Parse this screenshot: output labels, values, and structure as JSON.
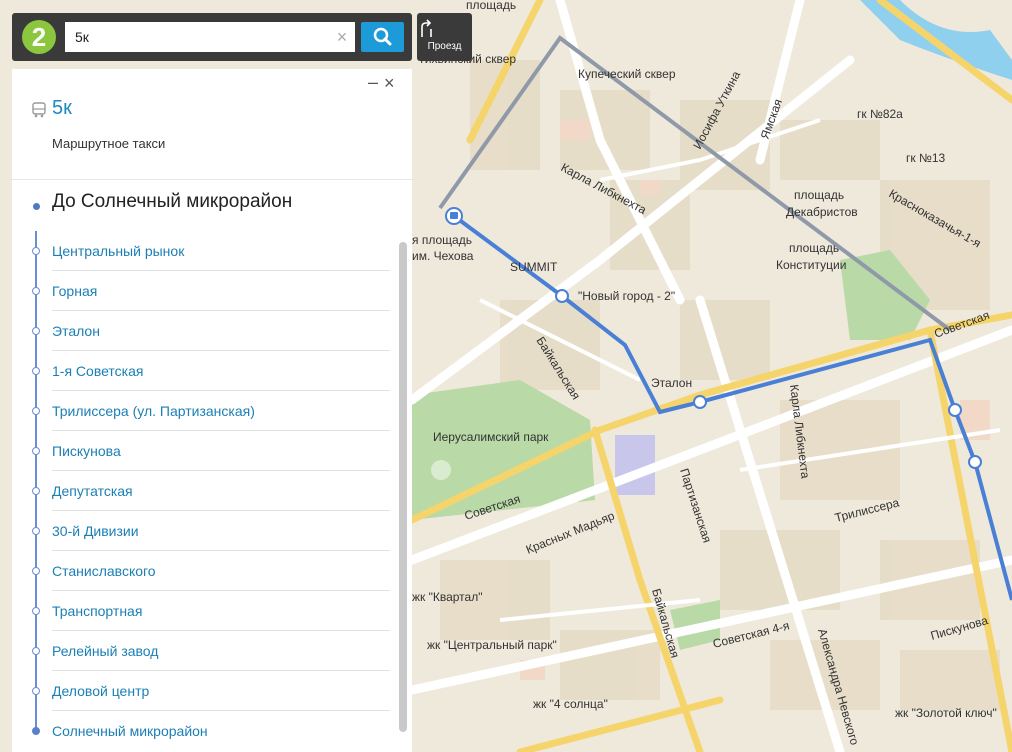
{
  "search": {
    "value": "5к",
    "clear_label": "×"
  },
  "directions": {
    "label": "Проезд"
  },
  "logo": {
    "text": "2"
  },
  "panel": {
    "minimize_label": "–",
    "close_label": "×",
    "route_number": "5к",
    "route_type": "Маршрутное такси",
    "destination": "До Солнечный микрорайон",
    "stops": [
      "Центральный рынок",
      "Горная",
      "Эталон",
      "1-я Советская",
      "Трилиссера (ул. Партизанская)",
      "Пискунова",
      "Депутатская",
      "30-й Дивизии",
      "Станиславского",
      "Транспортная",
      "Релейный завод",
      "Деловой центр",
      "Солнечный микрорайон"
    ]
  },
  "map": {
    "labels": {
      "ploshchad_top": "площадь",
      "tikhvinsky": "Тихвинский сквер",
      "kupechesky": "Купеческий сквер",
      "iosifa_utkina": "Иосифа Уткина",
      "yamskaya": "Ямская",
      "gk82a": "гк №82а",
      "gk13": "гк №13",
      "karla_libknekhta": "Карла Либкнехта",
      "ploshchad_dek": "площадь",
      "dekabristov": "Декабристов",
      "krasnokazachya": "Краснοказачья-1-я",
      "ploshchad_chekhova_a": "я площадь",
      "chekhova": "им. Чехова",
      "summit": "SUMMIT",
      "novy_gorod": "\"Новый город - 2\"",
      "ploshchad_konst": "площадь",
      "konstitutsii": "Конституции",
      "sovetskaya_right": "Советская",
      "baikalskaya": "Байкальская",
      "etalon": "Эталон",
      "karla_libknekhta2": "Карла Либкнехта",
      "ierusalimsky": "Иерусалимский парк",
      "sovetskaya": "Советская",
      "partizanskaya": "Партизанская",
      "krasnykh_madyar": "Красных Мадьяр",
      "trilissera": "Трилиссера",
      "kvartal": "жк \"Квартал\"",
      "tsentralny_park": "жк \"Центральный парк\"",
      "baikalskaya2": "Байкальская",
      "sovetskaya4": "Советская 4-я",
      "aleksandra_nevskogo": "Александра Невского",
      "piskunova": "Пискунова",
      "chetyre_solntsa": "жк \"4 солнца\"",
      "zolotoy_klyuch": "жк \"Золотой ключ\""
    }
  },
  "colors": {
    "accent": "#1b8bbf",
    "route_blue": "#4a7fd6",
    "route_grey": "#8f99a8",
    "search_button": "#1d9bd8",
    "logo_green": "#8cc63f",
    "toolbar": "#3a3a3a"
  }
}
